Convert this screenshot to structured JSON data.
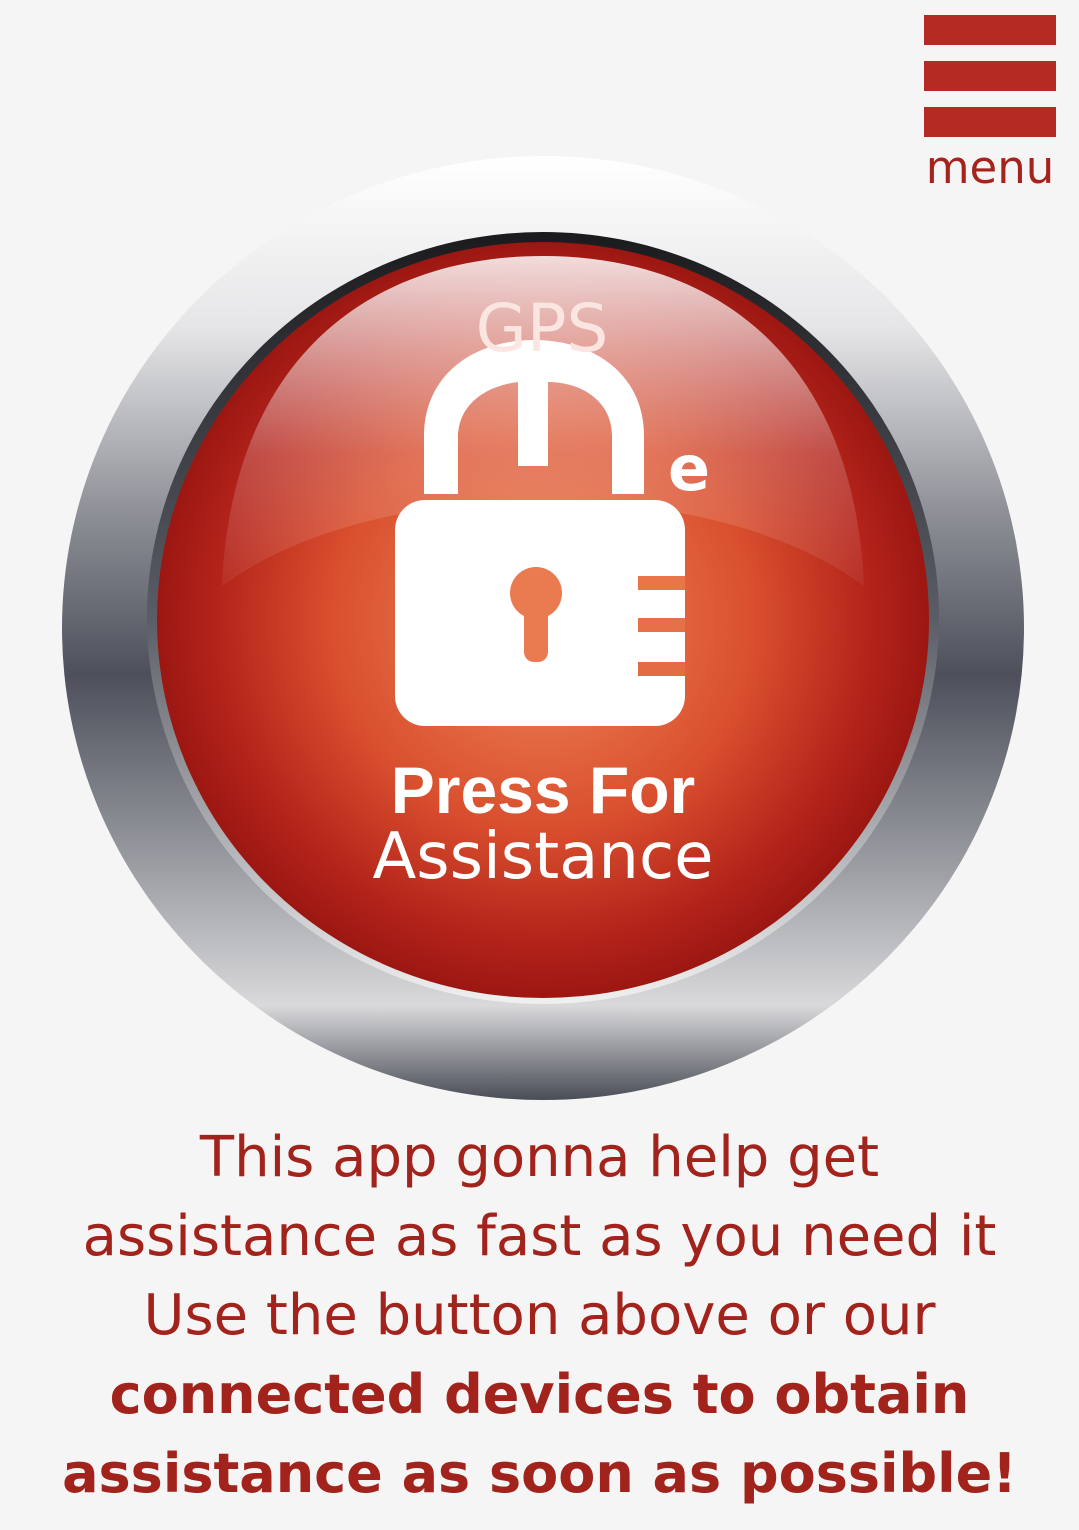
{
  "menu": {
    "label": "menu"
  },
  "assist_button": {
    "logo_top_text": "GPS",
    "logo_side_letter": "e",
    "press_text": "Press For",
    "assistance_text": "Assistance"
  },
  "description": {
    "line1": "This app gonna help get",
    "line2": "assistance as fast as you need it",
    "line3": "Use the button above or our",
    "line4": "connected devices to obtain",
    "line5": "assistance as soon as possible!"
  },
  "colors": {
    "accent_red": "#b52a22",
    "text_red": "#a2221c",
    "background": "#f5f5f5",
    "button_orange": "#e8734a"
  },
  "icons": {
    "menu": "hamburger-icon",
    "logo": "padlock-icon"
  }
}
